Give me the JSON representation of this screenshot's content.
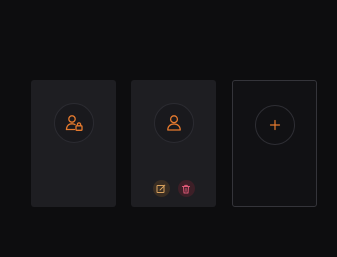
{
  "colors": {
    "background": "#0d0d0f",
    "card": "#1e1e22",
    "accent": "#e67a2e",
    "edit": "#d9a25e",
    "delete": "#e05a78"
  },
  "profiles": [
    {
      "icon": "user-lock-icon",
      "actions": []
    },
    {
      "icon": "user-icon",
      "actions": [
        "edit-icon",
        "delete-icon"
      ]
    }
  ],
  "add_card": {
    "icon": "plus-icon"
  }
}
